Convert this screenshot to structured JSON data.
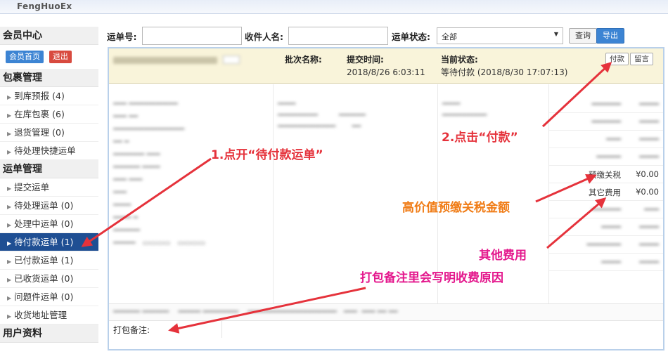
{
  "app": {
    "logo": "FengHuoEx"
  },
  "sidebar": {
    "member_title": "会员中心",
    "home_btn": "会员首页",
    "logout_btn": "退出",
    "parcel_title": "包裹管理",
    "parcel_items": [
      {
        "label": "到库预报",
        "count": "(4)"
      },
      {
        "label": "在库包裹",
        "count": "(6)"
      },
      {
        "label": "退货管理",
        "count": "(0)"
      },
      {
        "label": "待处理快捷运单",
        "count": ""
      }
    ],
    "waybill_title": "运单管理",
    "waybill_items": [
      {
        "label": "提交运单",
        "count": ""
      },
      {
        "label": "待处理运单",
        "count": "(0)"
      },
      {
        "label": "处理中运单",
        "count": "(0)"
      },
      {
        "label": "待付款运单",
        "count": "(1)"
      },
      {
        "label": "已付款运单",
        "count": "(1)"
      },
      {
        "label": "已收货运单",
        "count": "(0)"
      },
      {
        "label": "问题件运单",
        "count": "(0)"
      },
      {
        "label": "收货地址管理",
        "count": ""
      }
    ],
    "user_title": "用户资料"
  },
  "filter": {
    "waybill_label": "运单号:",
    "receiver_label": "收件人名:",
    "status_label": "运单状态:",
    "status_value": "全部",
    "search_btn": "查询",
    "export_btn": "导出"
  },
  "order": {
    "batch_label": "批次名称:",
    "submit_label": "提交时间:",
    "submit_value": "2018/8/26 6:03:11",
    "status_label": "当前状态:",
    "status_value": "等待付款 (2018/8/30 17:07:13)",
    "pay_btn": "付款",
    "msg_btn": "留言",
    "fees": [
      {
        "name": "预缴关税",
        "value": "¥0.00"
      },
      {
        "name": "其它费用",
        "value": "¥0.00"
      }
    ],
    "pack_note_label": "打包备注:"
  },
  "annotations": {
    "step1": "1.点开“待付款运单”",
    "step2": "2.点击“付款”",
    "tax": "高价值预缴关税金额",
    "other": "其他费用",
    "note": "打包备注里会写明收费原因"
  },
  "colors": {
    "red": "#e5323b",
    "orange": "#f07c16",
    "pink": "#e4188d",
    "active_nav": "#1f4f93"
  }
}
